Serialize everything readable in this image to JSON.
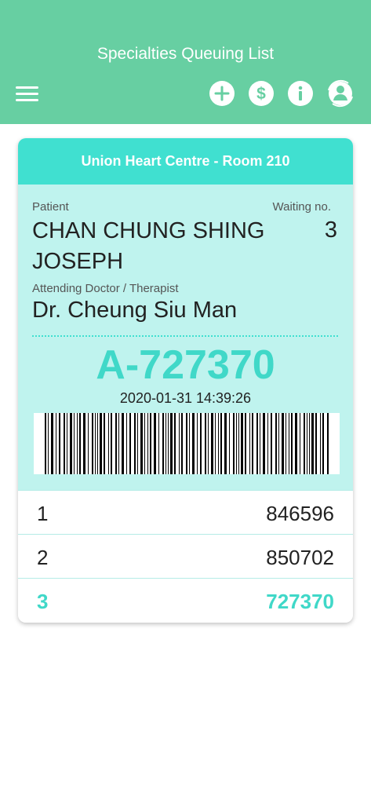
{
  "header": {
    "title": "Specialties Queuing List"
  },
  "toolbar": {
    "icons": [
      "add-icon",
      "dollar-icon",
      "info-icon",
      "user-refresh-icon"
    ]
  },
  "card": {
    "location": "Union Heart Centre - Room 210",
    "patient_label": "Patient",
    "patient_name": "CHAN CHUNG SHING JOSEPH",
    "waiting_label": "Waiting no.",
    "waiting_no": "3",
    "doctor_label": "Attending Doctor / Therapist",
    "doctor_name": "Dr. Cheung Siu Man",
    "ticket_no": "A-727370",
    "timestamp": "2020-01-31 14:39:26"
  },
  "queue": [
    {
      "index": "1",
      "number": "846596"
    },
    {
      "index": "2",
      "number": "850702"
    },
    {
      "index": "3",
      "number": "727370"
    }
  ],
  "colors": {
    "header": "#67cfa2",
    "accent": "#40e0d0",
    "ticket_bg": "#bff3ee"
  }
}
